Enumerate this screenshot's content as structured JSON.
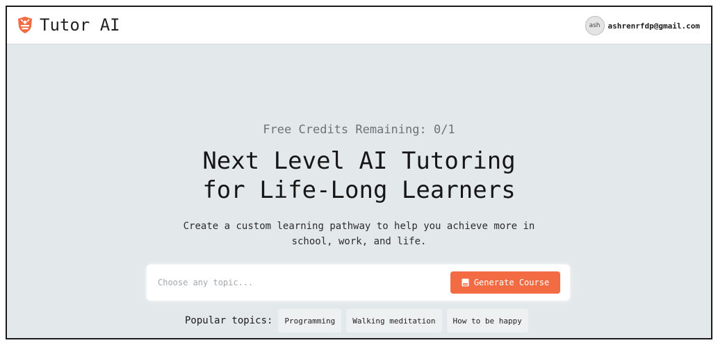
{
  "header": {
    "app_title": "Tutor AI",
    "logo_icon": "bee-shield-icon",
    "brand_color": "#f26b43",
    "user": {
      "avatar_initials": "ash",
      "email": "ashrenrfdp@gmail.com"
    }
  },
  "hero": {
    "credits_text": "Free Credits Remaining: 0/1",
    "headline_line1": "Next Level AI Tutoring",
    "headline_line2": "for Life-Long Learners",
    "subtitle_line1": "Create a custom learning pathway to help you achieve more in",
    "subtitle_line2": "school, work, and life."
  },
  "search": {
    "placeholder": "Choose any topic...",
    "value": "",
    "generate_label": "Generate Course",
    "generate_icon": "book-icon"
  },
  "popular": {
    "label": "Popular topics:",
    "topics": [
      "Programming",
      "Walking meditation",
      "How to be happy"
    ]
  }
}
